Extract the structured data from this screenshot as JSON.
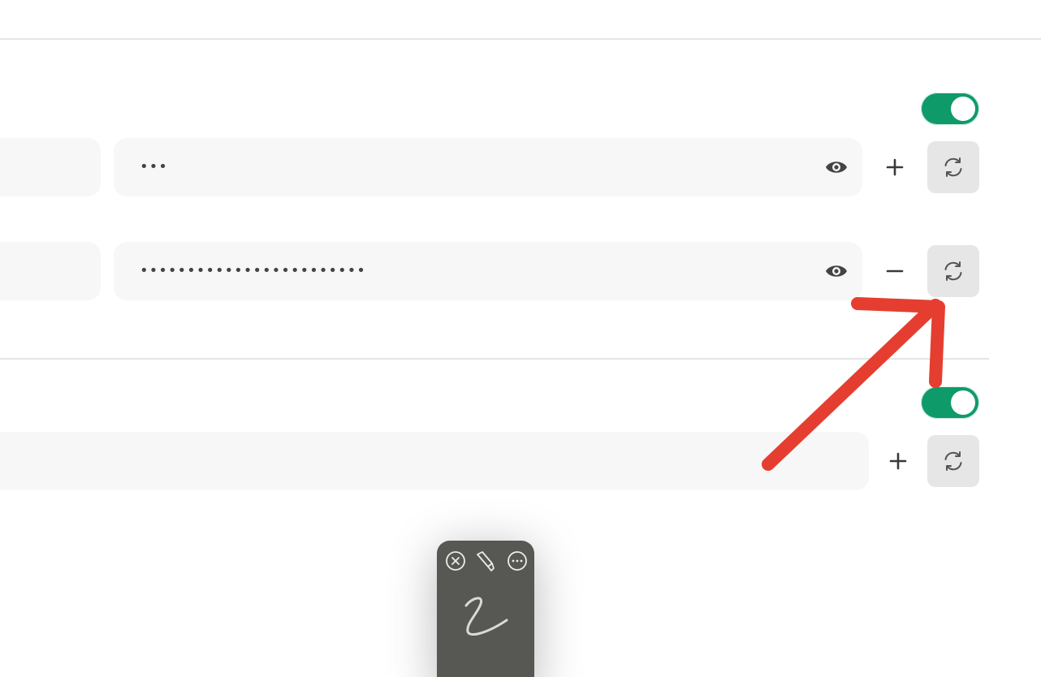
{
  "section1": {
    "toggle_on": true,
    "rows": [
      {
        "secret_value": "•••",
        "action": "add"
      },
      {
        "secret_value": "••••••••••••••••••••••••",
        "action": "remove"
      }
    ]
  },
  "section2": {
    "toggle_on": true,
    "row": {
      "action": "add"
    }
  },
  "annotation": {
    "arrow_color": "#e53e30"
  },
  "signature_panel": {
    "icons": [
      "close-icon",
      "highlighter-icon",
      "more-icon"
    ]
  },
  "colors": {
    "toggle_on": "#0f9a6a",
    "field_bg": "#f7f7f7",
    "button_bg": "#e6e6e6",
    "panel_bg": "#575753"
  }
}
